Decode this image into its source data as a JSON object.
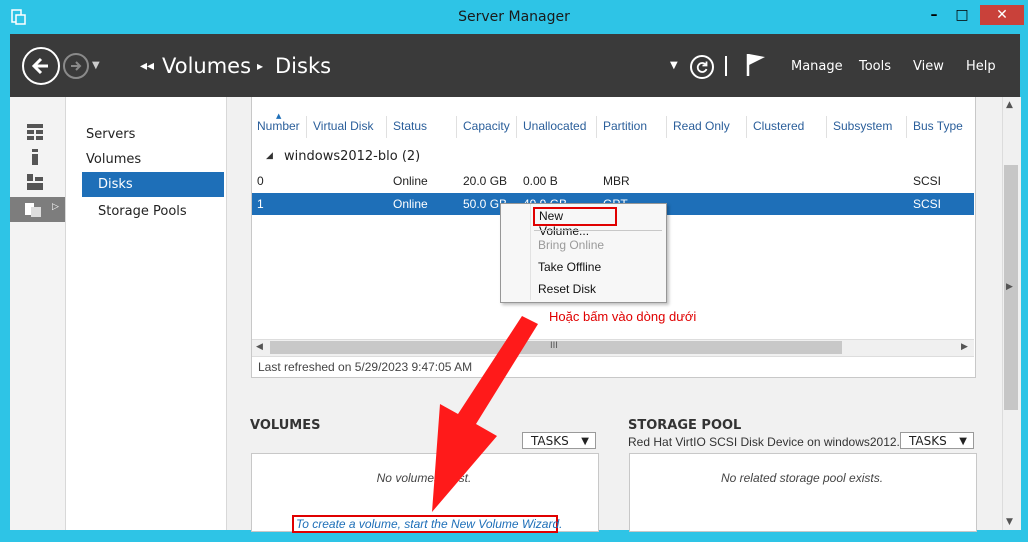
{
  "window": {
    "title": "Server Manager",
    "minimize": "–",
    "maximize": "□",
    "close": "✕"
  },
  "header": {
    "breadcrumb_root_arrow": "◂◂",
    "breadcrumb": [
      "Volumes",
      "Disks"
    ],
    "breadcrumb_sep": "▸",
    "menus": [
      "Manage",
      "Tools",
      "View",
      "Help"
    ]
  },
  "sidebar": {
    "items": [
      "Servers",
      "Volumes",
      "Disks",
      "Storage Pools"
    ],
    "selected": "Disks"
  },
  "disks": {
    "columns": [
      "Number",
      "Virtual Disk",
      "Status",
      "Capacity",
      "Unallocated",
      "Partition",
      "Read Only",
      "Clustered",
      "Subsystem",
      "Bus Type"
    ],
    "group": "windows2012-blo (2)",
    "rows": [
      {
        "number": "0",
        "status": "Online",
        "capacity": "20.0 GB",
        "unallocated": "0.00 B",
        "partition": "MBR",
        "bus_type": "SCSI"
      },
      {
        "number": "1",
        "status": "Online",
        "capacity": "50.0 GB",
        "unallocated": "49.9 GB",
        "partition": "GPT",
        "bus_type": "SCSI"
      }
    ],
    "scroll_grip": "III",
    "last_refreshed": "Last refreshed on 5/29/2023 9:47:05 AM"
  },
  "context_menu": {
    "items": [
      "New Volume...",
      "Bring Online",
      "Take Offline",
      "Reset Disk"
    ],
    "disabled": [
      "Bring Online"
    ]
  },
  "annotation": "Hoặc bấm vào dòng dưới",
  "volumes": {
    "title": "VOLUMES",
    "tasks_label": "TASKS",
    "empty_text": "No volumes exist.",
    "wizard_link": "To create a volume, start the New Volume Wizard."
  },
  "storage_pool": {
    "title": "STORAGE POOL",
    "subtitle": "Red Hat VirtIO SCSI Disk Device on windows2012...",
    "tasks_label": "TASKS",
    "empty_text": "No related storage pool exists."
  },
  "colors": {
    "accent": "#1e6fb8",
    "titlebar": "#2ec4e6",
    "header": "#3a3a3a",
    "annotation": "#e00000"
  }
}
